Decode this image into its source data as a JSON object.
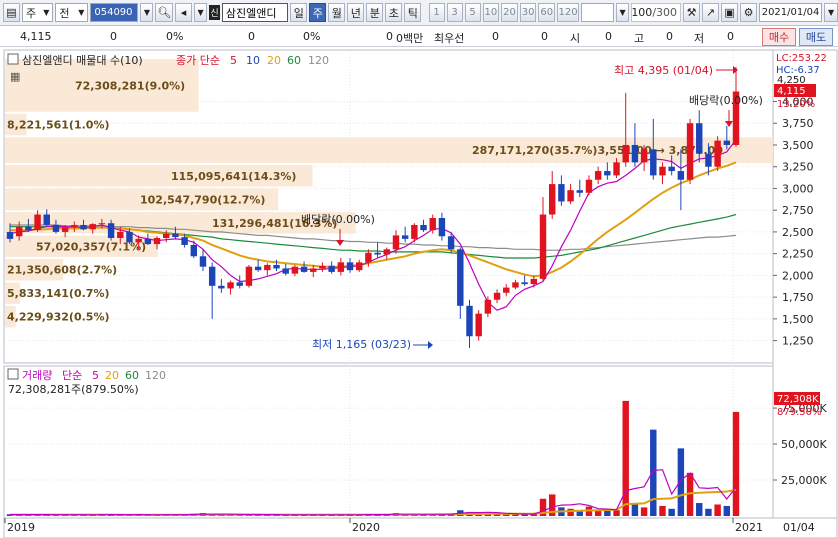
{
  "toolbar": {
    "market": "주",
    "type": "전",
    "code": "054090",
    "name_badge": "신",
    "stock_name": "삼진엘앤디",
    "periods": [
      "일",
      "주",
      "월",
      "년",
      "분",
      "초",
      "틱"
    ],
    "active_period": "주",
    "numbers": [
      "1",
      "3",
      "5",
      "10",
      "20",
      "30",
      "60",
      "120"
    ],
    "count": "100",
    "total": "/300",
    "date": "2021/01/04"
  },
  "quote": {
    "price": "4,115",
    "change": "0",
    "change_pct": "0%",
    "v2": "0",
    "v2_pct": "0%",
    "v3": "0",
    "v3_pct": "0%",
    "amount": "0백만",
    "priority_label": "최우선",
    "priority": "0",
    "p2": "0",
    "open_label": "시",
    "open": "0",
    "high_label": "고",
    "high": "0",
    "low_label": "저",
    "low": "0",
    "buy": "매수",
    "sell": "매도"
  },
  "price_panel": {
    "title": "삼진엘앤디 매물대 수(10)",
    "ma_title": "종가 단순",
    "ma_periods": [
      "5",
      "10",
      "20",
      "60",
      "120"
    ],
    "ma_colors": [
      "#d4142a",
      "#1c46b8",
      "#e0a010",
      "#1a8a3a",
      "#8c8c8c"
    ],
    "lc": "LC:253.22",
    "hc": "HC:-6.37",
    "current_price": "4,115",
    "current_pct": "13.20%",
    "top_tick": "4,250",
    "high_label": "최고 4,395 (01/04)",
    "low_label": "최저 1,165 (03/23)",
    "dividend_labels": [
      "배당락(0.00%)",
      "배당락(0.00%)"
    ],
    "volume_profile": [
      "72,308,281(9.0%)",
      "8,221,561(1.0%)",
      "287,171,270(35.7%)3,551.00 → 3,878.00",
      "115,095,641(14.3%)",
      "102,547,790(12.7%)",
      "131,296,481(16.3%)",
      "57,020,357(7.1%)",
      "21,350,608(2.7%)",
      "5,833,141(0.7%)",
      "4,229,932(0.5%)"
    ]
  },
  "volume_panel": {
    "title": "거래량",
    "ma_title": "단순",
    "ma_periods": [
      "5",
      "20",
      "60",
      "120"
    ],
    "ma_colors": [
      "#c000c0",
      "#e0a010",
      "#1a8a3a",
      "#8c8c8c"
    ],
    "last_value_label": "72,308,281주(879.50%)",
    "current_volume": "72,308K",
    "current_pct": "879.50%"
  },
  "x_axis": {
    "labels": [
      "2019",
      "2020",
      "2021",
      "01/04"
    ]
  },
  "chart_data": [
    {
      "type": "candlestick",
      "name": "price",
      "y_ticks": [
        1250,
        1500,
        1750,
        2000,
        2250,
        2500,
        2750,
        3000,
        3250,
        3500,
        3750,
        4000,
        4250
      ],
      "ylim": [
        1050,
        4500
      ],
      "ohlc": [
        [
          2500,
          2600,
          2380,
          2420
        ],
        [
          2450,
          2620,
          2400,
          2560
        ],
        [
          2560,
          2650,
          2500,
          2520
        ],
        [
          2520,
          2750,
          2500,
          2700
        ],
        [
          2700,
          2760,
          2560,
          2580
        ],
        [
          2580,
          2640,
          2480,
          2500
        ],
        [
          2500,
          2580,
          2440,
          2550
        ],
        [
          2550,
          2620,
          2500,
          2580
        ],
        [
          2580,
          2640,
          2520,
          2530
        ],
        [
          2530,
          2600,
          2480,
          2590
        ],
        [
          2590,
          2650,
          2540,
          2600
        ],
        [
          2600,
          2640,
          2400,
          2430
        ],
        [
          2430,
          2560,
          2360,
          2500
        ],
        [
          2500,
          2540,
          2360,
          2380
        ],
        [
          2380,
          2460,
          2300,
          2420
        ],
        [
          2420,
          2480,
          2350,
          2360
        ],
        [
          2360,
          2450,
          2300,
          2430
        ],
        [
          2430,
          2520,
          2380,
          2480
        ],
        [
          2480,
          2560,
          2420,
          2440
        ],
        [
          2440,
          2480,
          2320,
          2350
        ],
        [
          2350,
          2400,
          2200,
          2220
        ],
        [
          2220,
          2300,
          2050,
          2100
        ],
        [
          2100,
          2150,
          1500,
          1880
        ],
        [
          1880,
          1960,
          1800,
          1850
        ],
        [
          1850,
          1940,
          1780,
          1920
        ],
        [
          1920,
          2000,
          1850,
          1880
        ],
        [
          1880,
          2120,
          1860,
          2100
        ],
        [
          2100,
          2180,
          2040,
          2060
        ],
        [
          2060,
          2140,
          2000,
          2120
        ],
        [
          2120,
          2180,
          2050,
          2080
        ],
        [
          2080,
          2130,
          2000,
          2020
        ],
        [
          2020,
          2120,
          1990,
          2100
        ],
        [
          2100,
          2160,
          2030,
          2040
        ],
        [
          2040,
          2120,
          1980,
          2080
        ],
        [
          2080,
          2150,
          2040,
          2110
        ],
        [
          2110,
          2160,
          2020,
          2040
        ],
        [
          2040,
          2200,
          2000,
          2150
        ],
        [
          2150,
          2200,
          2030,
          2060
        ],
        [
          2060,
          2180,
          2040,
          2150
        ],
        [
          2150,
          2300,
          2100,
          2260
        ],
        [
          2260,
          2380,
          2200,
          2240
        ],
        [
          2240,
          2320,
          2180,
          2300
        ],
        [
          2300,
          2520,
          2250,
          2460
        ],
        [
          2460,
          2560,
          2380,
          2420
        ],
        [
          2420,
          2600,
          2380,
          2580
        ],
        [
          2580,
          2640,
          2500,
          2520
        ],
        [
          2520,
          2700,
          2480,
          2660
        ],
        [
          2660,
          2720,
          2400,
          2450
        ],
        [
          2450,
          2500,
          2250,
          2300
        ],
        [
          2300,
          2320,
          1500,
          1650
        ],
        [
          1650,
          1720,
          1165,
          1300
        ],
        [
          1300,
          1600,
          1250,
          1560
        ],
        [
          1560,
          1760,
          1520,
          1720
        ],
        [
          1720,
          1840,
          1680,
          1800
        ],
        [
          1800,
          1900,
          1760,
          1860
        ],
        [
          1860,
          1950,
          1840,
          1920
        ],
        [
          1920,
          2000,
          1880,
          1900
        ],
        [
          1900,
          2000,
          1860,
          1960
        ],
        [
          1960,
          2900,
          1940,
          2700
        ],
        [
          2700,
          3200,
          2650,
          3050
        ],
        [
          3050,
          3150,
          2800,
          2850
        ],
        [
          2850,
          3050,
          2820,
          2980
        ],
        [
          2980,
          3100,
          2900,
          2950
        ],
        [
          2950,
          3150,
          2920,
          3100
        ],
        [
          3100,
          3250,
          3050,
          3200
        ],
        [
          3200,
          3300,
          3100,
          3150
        ],
        [
          3150,
          3350,
          3120,
          3300
        ],
        [
          3300,
          4100,
          3250,
          3500
        ],
        [
          3500,
          3750,
          3250,
          3300
        ],
        [
          3300,
          3500,
          3200,
          3450
        ],
        [
          3450,
          3800,
          3100,
          3150
        ],
        [
          3150,
          3300,
          3050,
          3250
        ],
        [
          3250,
          3380,
          3150,
          3200
        ],
        [
          3200,
          3450,
          2750,
          3100
        ],
        [
          3100,
          3800,
          3050,
          3750
        ],
        [
          3750,
          3900,
          3300,
          3400
        ],
        [
          3400,
          3520,
          3150,
          3250
        ],
        [
          3250,
          3600,
          3200,
          3550
        ],
        [
          3550,
          3720,
          3450,
          3500
        ],
        [
          3500,
          4395,
          3480,
          4115
        ]
      ],
      "ma5": [
        2480,
        2500,
        2510,
        2540,
        2560,
        2570,
        2560,
        2560,
        2550,
        2560,
        2580,
        2550,
        2520,
        2500,
        2440,
        2420,
        2400,
        2410,
        2420,
        2410,
        2380,
        2300,
        2180,
        2100,
        2000,
        1930,
        1940,
        1960,
        1990,
        2020,
        2070,
        2080,
        2070,
        2070,
        2070,
        2080,
        2090,
        2100,
        2110,
        2150,
        2200,
        2240,
        2290,
        2330,
        2400,
        2460,
        2530,
        2540,
        2490,
        2360,
        2140,
        1900,
        1690,
        1600,
        1640,
        1770,
        1840,
        1880,
        1930,
        2110,
        2330,
        2520,
        2740,
        2950,
        3020,
        3060,
        3080,
        3150,
        3230,
        3320,
        3340,
        3330,
        3310,
        3230,
        3290,
        3340,
        3350,
        3380,
        3420,
        3560
      ],
      "ma20": [
        2520,
        2520,
        2520,
        2530,
        2530,
        2540,
        2540,
        2540,
        2540,
        2550,
        2550,
        2550,
        2540,
        2530,
        2520,
        2500,
        2490,
        2480,
        2470,
        2460,
        2430,
        2400,
        2350,
        2310,
        2270,
        2230,
        2200,
        2180,
        2160,
        2150,
        2140,
        2130,
        2120,
        2110,
        2100,
        2100,
        2100,
        2110,
        2120,
        2140,
        2160,
        2180,
        2200,
        2220,
        2250,
        2270,
        2290,
        2300,
        2290,
        2260,
        2230,
        2190,
        2150,
        2110,
        2070,
        2040,
        2010,
        1990,
        2000,
        2040,
        2090,
        2160,
        2240,
        2330,
        2420,
        2500,
        2570,
        2640,
        2720,
        2800,
        2880,
        2950,
        3010,
        3060,
        3100,
        3150,
        3190,
        3230,
        3260,
        3300
      ],
      "ma60": [
        2560,
        2560,
        2560,
        2560,
        2560,
        2560,
        2550,
        2550,
        2550,
        2550,
        2550,
        2540,
        2540,
        2530,
        2520,
        2510,
        2500,
        2490,
        2480,
        2470,
        2460,
        2450,
        2440,
        2420,
        2410,
        2400,
        2390,
        2380,
        2370,
        2360,
        2350,
        2340,
        2330,
        2320,
        2310,
        2300,
        2290,
        2290,
        2280,
        2280,
        2280,
        2270,
        2270,
        2270,
        2270,
        2270,
        2270,
        2270,
        2260,
        2250,
        2240,
        2230,
        2220,
        2210,
        2200,
        2200,
        2200,
        2200,
        2210,
        2220,
        2230,
        2250,
        2270,
        2290,
        2310,
        2340,
        2370,
        2400,
        2430,
        2460,
        2490,
        2520,
        2550,
        2570,
        2590,
        2610,
        2630,
        2650,
        2670,
        2700
      ],
      "ma120": [
        2580,
        2580,
        2580,
        2580,
        2580,
        2580,
        2570,
        2570,
        2570,
        2570,
        2570,
        2560,
        2560,
        2560,
        2550,
        2550,
        2540,
        2540,
        2530,
        2530,
        2520,
        2510,
        2500,
        2500,
        2490,
        2480,
        2470,
        2460,
        2460,
        2450,
        2440,
        2430,
        2420,
        2420,
        2410,
        2400,
        2400,
        2390,
        2390,
        2380,
        2380,
        2370,
        2370,
        2360,
        2360,
        2350,
        2350,
        2340,
        2340,
        2330,
        2330,
        2320,
        2320,
        2310,
        2310,
        2300,
        2300,
        2300,
        2290,
        2290,
        2290,
        2300,
        2300,
        2310,
        2320,
        2330,
        2340,
        2350,
        2360,
        2370,
        2380,
        2390,
        2400,
        2410,
        2420,
        2430,
        2440,
        2440,
        2450,
        2460
      ]
    },
    {
      "type": "bar",
      "name": "volume",
      "y_ticks": [
        25000000,
        50000000,
        75000000
      ],
      "y_tick_labels": [
        "25,000K",
        "50,000K",
        "75,000K"
      ],
      "ylim": [
        0,
        82000000
      ],
      "values": [
        1200000,
        900000,
        800000,
        1000000,
        1100000,
        700000,
        900000,
        800000,
        1000000,
        700000,
        900000,
        1200000,
        800000,
        700000,
        1000000,
        900000,
        700000,
        1000000,
        800000,
        900000,
        1500000,
        2000000,
        1200000,
        1000000,
        900000,
        800000,
        1300000,
        1000000,
        900000,
        800000,
        700000,
        900000,
        800000,
        700000,
        900000,
        800000,
        900000,
        700000,
        900000,
        1400000,
        1000000,
        800000,
        2000000,
        1000000,
        1200000,
        900000,
        1100000,
        1500000,
        1800000,
        4000000,
        2600000,
        2000000,
        1800000,
        1500000,
        1400000,
        1200000,
        1100000,
        1300000,
        12000000,
        15000000,
        6000000,
        5000000,
        4000000,
        6500000,
        4000000,
        3500000,
        4000000,
        80000000,
        8000000,
        6000000,
        60000000,
        7000000,
        5000000,
        47000000,
        30000000,
        9000000,
        5000000,
        8000000,
        7000000,
        72308281
      ],
      "ma5": [
        1000000,
        1000000,
        950000,
        950000,
        1000000,
        900000,
        900000,
        900000,
        900000,
        850000,
        900000,
        950000,
        950000,
        900000,
        950000,
        900000,
        850000,
        900000,
        900000,
        900000,
        1100000,
        1300000,
        1300000,
        1300000,
        1300000,
        1200000,
        1050000,
        1050000,
        1000000,
        950000,
        850000,
        850000,
        800000,
        800000,
        800000,
        800000,
        820000,
        800000,
        820000,
        950000,
        960000,
        950000,
        1220000,
        1240000,
        1280000,
        1180000,
        1240000,
        1160000,
        1300000,
        1860000,
        2400000,
        2380000,
        2540000,
        2340000,
        1860000,
        1580000,
        1400000,
        1300000,
        3420000,
        6180000,
        7600000,
        7700000,
        8500000,
        7300000,
        5100000,
        4800000,
        4400000,
        17600000,
        19100000,
        20300000,
        31600000,
        32200000,
        15200000,
        25000000,
        29800000,
        19600000,
        19200000,
        19800000,
        11800000,
        20000000
      ],
      "ma20": [
        1000000,
        1000000,
        1000000,
        1000000,
        1000000,
        950000,
        950000,
        950000,
        950000,
        950000,
        940000,
        940000,
        930000,
        920000,
        920000,
        910000,
        900000,
        900000,
        900000,
        900000,
        920000,
        960000,
        980000,
        990000,
        990000,
        990000,
        1000000,
        1000000,
        1000000,
        1000000,
        980000,
        970000,
        960000,
        950000,
        950000,
        940000,
        950000,
        940000,
        940000,
        960000,
        960000,
        950000,
        1000000,
        1000000,
        1020000,
        1030000,
        1050000,
        1080000,
        1120000,
        1280000,
        1360000,
        1420000,
        1480000,
        1520000,
        1560000,
        1580000,
        1600000,
        1640000,
        2180000,
        2880000,
        3180000,
        3420000,
        3620000,
        3880000,
        4040000,
        4160000,
        4280000,
        8200000,
        8520000,
        8740000,
        11740000,
        12000000,
        12200000,
        14400000,
        15800000,
        16200000,
        16400000,
        16700000,
        17000000,
        18200000
      ]
    }
  ]
}
